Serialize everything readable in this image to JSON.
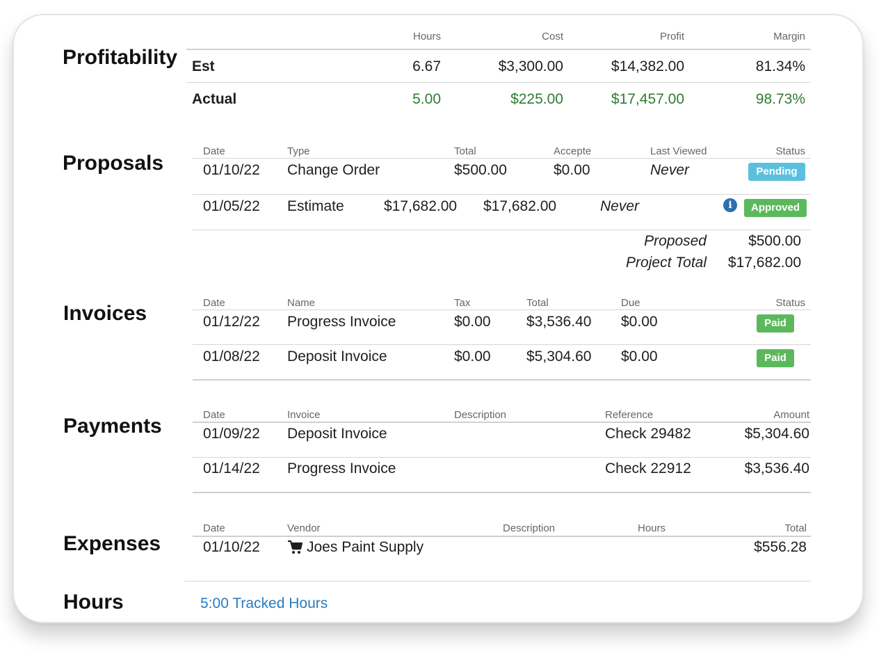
{
  "profitability": {
    "title": "Profitability",
    "headers": [
      "Hours",
      "Cost",
      "Profit",
      "Margin"
    ],
    "rows": [
      {
        "label": "Est",
        "hours": "6.67",
        "cost": "$3,300.00",
        "profit": "$14,382.00",
        "margin": "81.34%"
      },
      {
        "label": "Actual",
        "hours": "5.00",
        "cost": "$225.00",
        "profit": "$17,457.00",
        "margin": "98.73%"
      }
    ],
    "actual_color": "#2e7d32"
  },
  "proposals": {
    "title": "Proposals",
    "headers": {
      "date": "Date",
      "type": "Type",
      "total": "Total",
      "accepted": "Accepte",
      "last_viewed": "Last Viewed",
      "status": "Status"
    },
    "rows": [
      {
        "date": "01/10/22",
        "type": "Change Order",
        "total": "$500.00",
        "accepted": "$0.00",
        "last_viewed": "Never",
        "status": "Pending"
      },
      {
        "date": "01/05/22",
        "type": "Estimate",
        "total": "$17,682.00",
        "accepted": "$17,682.00",
        "last_viewed": "Never",
        "status": "Approved",
        "info_icon": "info-icon"
      }
    ],
    "summary": {
      "proposed_label": "Proposed",
      "proposed_value": "$500.00",
      "project_total_label": "Project Total",
      "project_total_value": "$17,682.00"
    },
    "status_colors": {
      "Pending": "#5bc0de",
      "Approved": "#5cb85c"
    }
  },
  "invoices": {
    "title": "Invoices",
    "headers": {
      "date": "Date",
      "name": "Name",
      "tax": "Tax",
      "total": "Total",
      "due": "Due",
      "status": "Status"
    },
    "rows": [
      {
        "date": "01/12/22",
        "name": "Progress Invoice",
        "tax": "$0.00",
        "total": "$3,536.40",
        "due": "$0.00",
        "status": "Paid"
      },
      {
        "date": "01/08/22",
        "name": "Deposit Invoice",
        "tax": "$0.00",
        "total": "$5,304.60",
        "due": "$0.00",
        "status": "Paid"
      }
    ],
    "status_colors": {
      "Paid": "#5cb85c"
    }
  },
  "payments": {
    "title": "Payments",
    "headers": {
      "date": "Date",
      "invoice": "Invoice",
      "description": "Description",
      "reference": "Reference",
      "amount": "Amount"
    },
    "rows": [
      {
        "date": "01/09/22",
        "invoice": "Deposit Invoice",
        "description": "",
        "reference": "Check 29482",
        "amount": "$5,304.60"
      },
      {
        "date": "01/14/22",
        "invoice": "Progress Invoice",
        "description": "",
        "reference": "Check 22912",
        "amount": "$3,536.40"
      }
    ]
  },
  "expenses": {
    "title": "Expenses",
    "headers": {
      "date": "Date",
      "vendor": "Vendor",
      "description": "Description",
      "hours": "Hours",
      "total": "Total"
    },
    "rows": [
      {
        "date": "01/10/22",
        "vendor": "Joes Paint Supply",
        "vendor_icon": "cart-icon",
        "description": "",
        "hours": "",
        "total": "$556.28"
      }
    ]
  },
  "hours": {
    "title": "Hours",
    "tracked_link": "5:00 Tracked Hours",
    "link_color": "#2a7bbf"
  }
}
